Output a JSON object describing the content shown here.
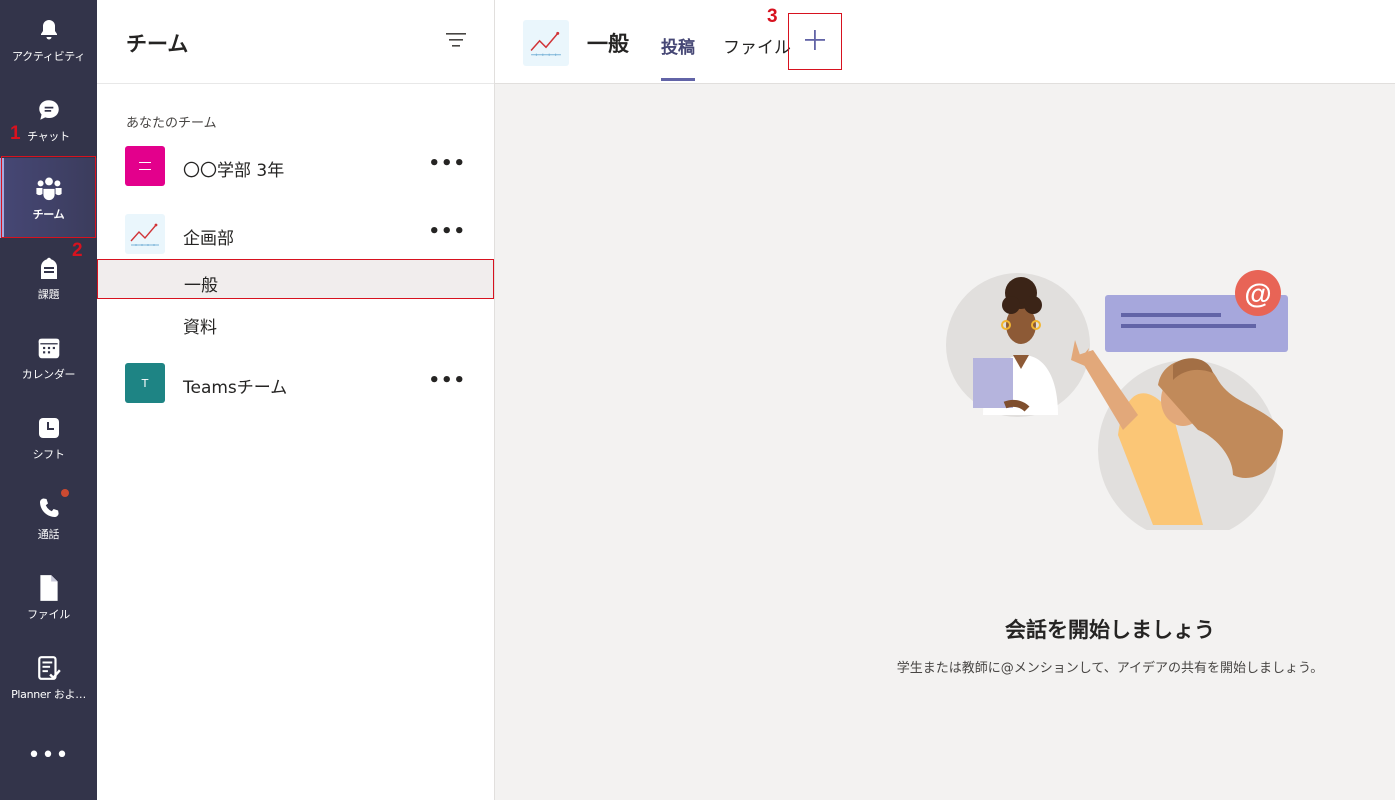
{
  "rail": {
    "items": [
      {
        "label": "アクティビティ",
        "icon": "bell-icon"
      },
      {
        "label": "チャット",
        "icon": "chat-icon"
      },
      {
        "label": "チーム",
        "icon": "teams-icon",
        "active": true
      },
      {
        "label": "課題",
        "icon": "assignments-icon"
      },
      {
        "label": "カレンダー",
        "icon": "calendar-icon"
      },
      {
        "label": "シフト",
        "icon": "shifts-icon"
      },
      {
        "label": "通話",
        "icon": "phone-icon",
        "notification": true
      },
      {
        "label": "ファイル",
        "icon": "file-icon"
      },
      {
        "label": "Planner およ…",
        "icon": "planner-icon"
      }
    ],
    "more_label": "•••"
  },
  "panel": {
    "title": "チーム",
    "section_label": "あなたのチーム",
    "teams": [
      {
        "name": "〇〇学部 3年",
        "avatar_color": "#e3008c",
        "more": "•••"
      },
      {
        "name": "企画部",
        "avatar_color": "#eaf6fc",
        "more": "•••",
        "channels": [
          "一般",
          "資料"
        ]
      },
      {
        "name": "Teamsチーム",
        "avatar_color": "#1e8484",
        "avatar_letter": "T",
        "more": "•••"
      }
    ]
  },
  "main": {
    "channel_name": "一般",
    "tabs": [
      "投稿",
      "ファイル"
    ],
    "add_tab_label": "+",
    "empty_title": "会話を開始しましょう",
    "empty_subtitle": "学生または教師に@メンションして、アイデアの共有を開始しましょう。"
  },
  "steps": [
    "1",
    "2",
    "3"
  ],
  "colors": {
    "rail_bg": "#33344a",
    "accent": "#6264a7",
    "highlight": "#d7121f"
  }
}
